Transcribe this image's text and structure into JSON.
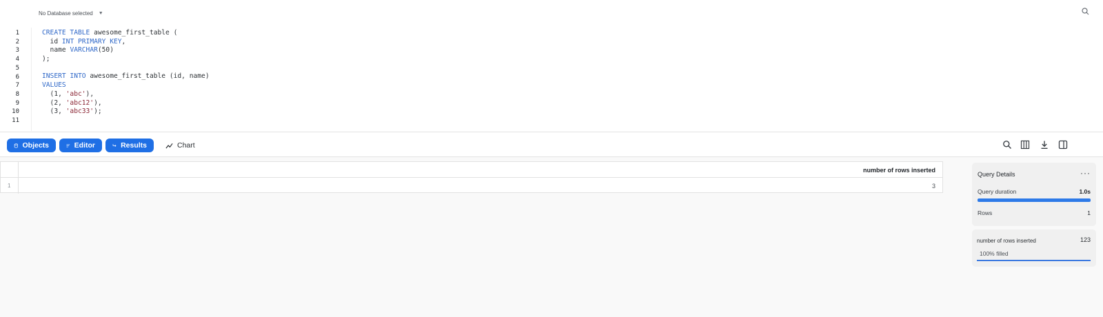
{
  "header": {
    "database_selector": "No Database selected"
  },
  "editor": {
    "line_numbers": [
      "1",
      "2",
      "3",
      "4",
      "5",
      "6",
      "7",
      "8",
      "9",
      "10",
      "11"
    ]
  },
  "toolbar": {
    "tabs": [
      {
        "label": "Objects"
      },
      {
        "label": "Editor"
      },
      {
        "label": "Results"
      },
      {
        "label": "Chart"
      }
    ]
  },
  "results": {
    "column_header": "number of rows inserted",
    "rows": [
      {
        "row_number": "1",
        "value": "3"
      }
    ]
  },
  "query_details": {
    "title": "Query Details",
    "duration_label": "Query duration",
    "duration_value": "1.0s",
    "duration_progress_fraction": 1.0,
    "rows_label": "Rows",
    "rows_value": "1"
  },
  "column_panel": {
    "column_name": "number of rows inserted",
    "value": "123",
    "fill_text": "100% filled"
  },
  "colors": {
    "accent": "#1f6fe5",
    "keyword": "#2f68c8",
    "string": "#8a2433"
  }
}
